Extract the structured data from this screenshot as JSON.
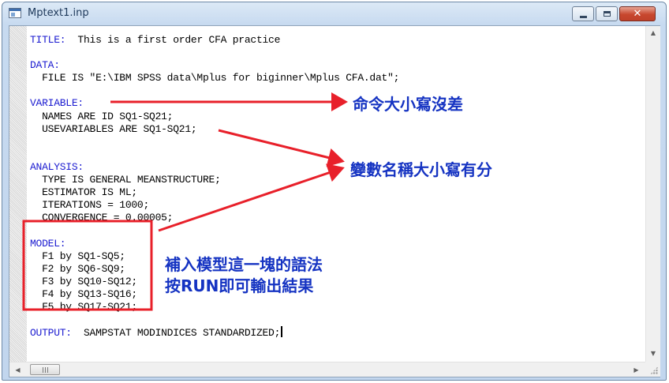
{
  "window": {
    "title": "Mptext1.inp",
    "controls": {
      "close": "✕"
    }
  },
  "editor": {
    "lines": [
      {
        "kw": "TITLE:",
        "rest": "  This is a first order CFA practice"
      },
      {
        "kw": "",
        "rest": ""
      },
      {
        "kw": "DATA:",
        "rest": ""
      },
      {
        "kw": "",
        "rest": "  FILE IS \"E:\\IBM SPSS data\\Mplus for biginner\\Mplus CFA.dat\";"
      },
      {
        "kw": "",
        "rest": ""
      },
      {
        "kw": "VARIABLE:",
        "rest": ""
      },
      {
        "kw": "",
        "rest": "  NAMES ARE ID SQ1-SQ21;"
      },
      {
        "kw": "",
        "rest": "  USEVARIABLES ARE SQ1-SQ21;"
      },
      {
        "kw": "",
        "rest": ""
      },
      {
        "kw": "",
        "rest": ""
      },
      {
        "kw": "ANALYSIS:",
        "rest": ""
      },
      {
        "kw": "",
        "rest": "  TYPE IS GENERAL MEANSTRUCTURE;"
      },
      {
        "kw": "",
        "rest": "  ESTIMATOR IS ML;"
      },
      {
        "kw": "",
        "rest": "  ITERATIONS = 1000;"
      },
      {
        "kw": "",
        "rest": "  CONVERGENCE = 0.00005;"
      },
      {
        "kw": "",
        "rest": ""
      },
      {
        "kw": "MODEL:",
        "rest": ""
      },
      {
        "kw": "",
        "rest": "  F1 by SQ1-SQ5;"
      },
      {
        "kw": "",
        "rest": "  F2 by SQ6-SQ9;"
      },
      {
        "kw": "",
        "rest": "  F3 by SQ10-SQ12;"
      },
      {
        "kw": "",
        "rest": "  F4 by SQ13-SQ16;"
      },
      {
        "kw": "",
        "rest": "  F5 by SQ17-SQ21;"
      },
      {
        "kw": "",
        "rest": ""
      },
      {
        "kw": "OUTPUT:",
        "rest": "  SAMPSTAT MODINDICES STANDARDIZED;"
      }
    ]
  },
  "scrollbars": {
    "up_arrow": "▲",
    "down_arrow": "▼",
    "left_arrow": "◀",
    "right_arrow": "▶"
  },
  "annotations": {
    "case_insensitive_note": "命令大小寫沒差",
    "case_sensitive_note": "變數名稱大小寫有分",
    "model_note_line1": "補入模型這一塊的語法",
    "model_note_line2": "按RUN即可輸出結果"
  },
  "colors": {
    "keyword": "#1b1bd0",
    "annotation_text": "#1533c2",
    "annotation_arrow": "#e8202a"
  }
}
